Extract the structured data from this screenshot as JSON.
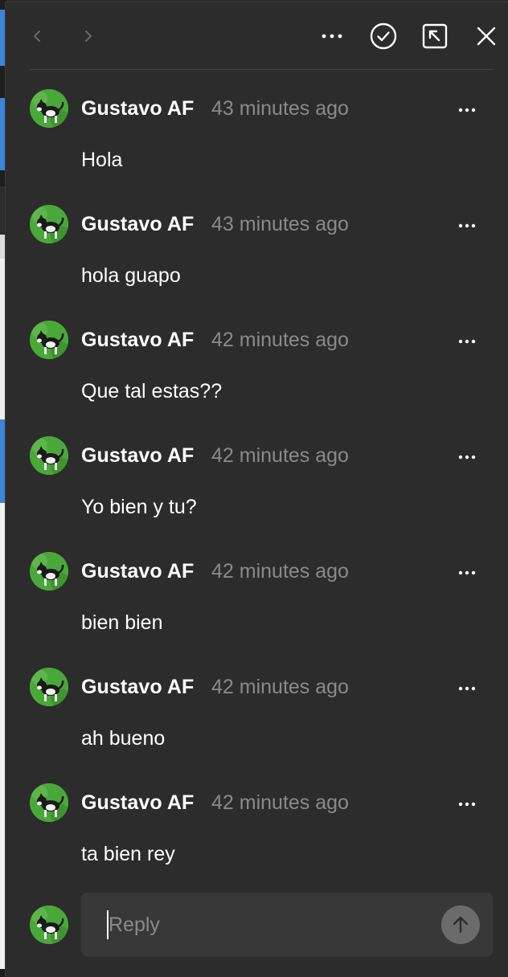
{
  "colors": {
    "panel_bg": "#2c2c2c",
    "text_primary": "#ffffff",
    "text_secondary": "#8a8a8a",
    "input_bg": "#383838",
    "send_button": "#6b6b6b",
    "avatar_bg": "#4aa83a"
  },
  "toolbar": {
    "icons": [
      "chevron-left-icon",
      "chevron-right-icon",
      "more-horizontal-icon",
      "resolve-check-icon",
      "open-external-icon",
      "close-icon"
    ]
  },
  "comments": [
    {
      "author": "Gustavo AF",
      "time": "43 minutes ago",
      "text": "Hola"
    },
    {
      "author": "Gustavo AF",
      "time": "43 minutes ago",
      "text": "hola guapo"
    },
    {
      "author": "Gustavo AF",
      "time": "42 minutes ago",
      "text": "Que tal estas??"
    },
    {
      "author": "Gustavo AF",
      "time": "42 minutes ago",
      "text": "Yo bien y tu?"
    },
    {
      "author": "Gustavo AF",
      "time": "42 minutes ago",
      "text": "bien bien"
    },
    {
      "author": "Gustavo AF",
      "time": "42 minutes ago",
      "text": "ah bueno"
    },
    {
      "author": "Gustavo AF",
      "time": "42 minutes ago",
      "text": "ta bien rey"
    }
  ],
  "reply": {
    "placeholder": "Reply",
    "value": ""
  }
}
